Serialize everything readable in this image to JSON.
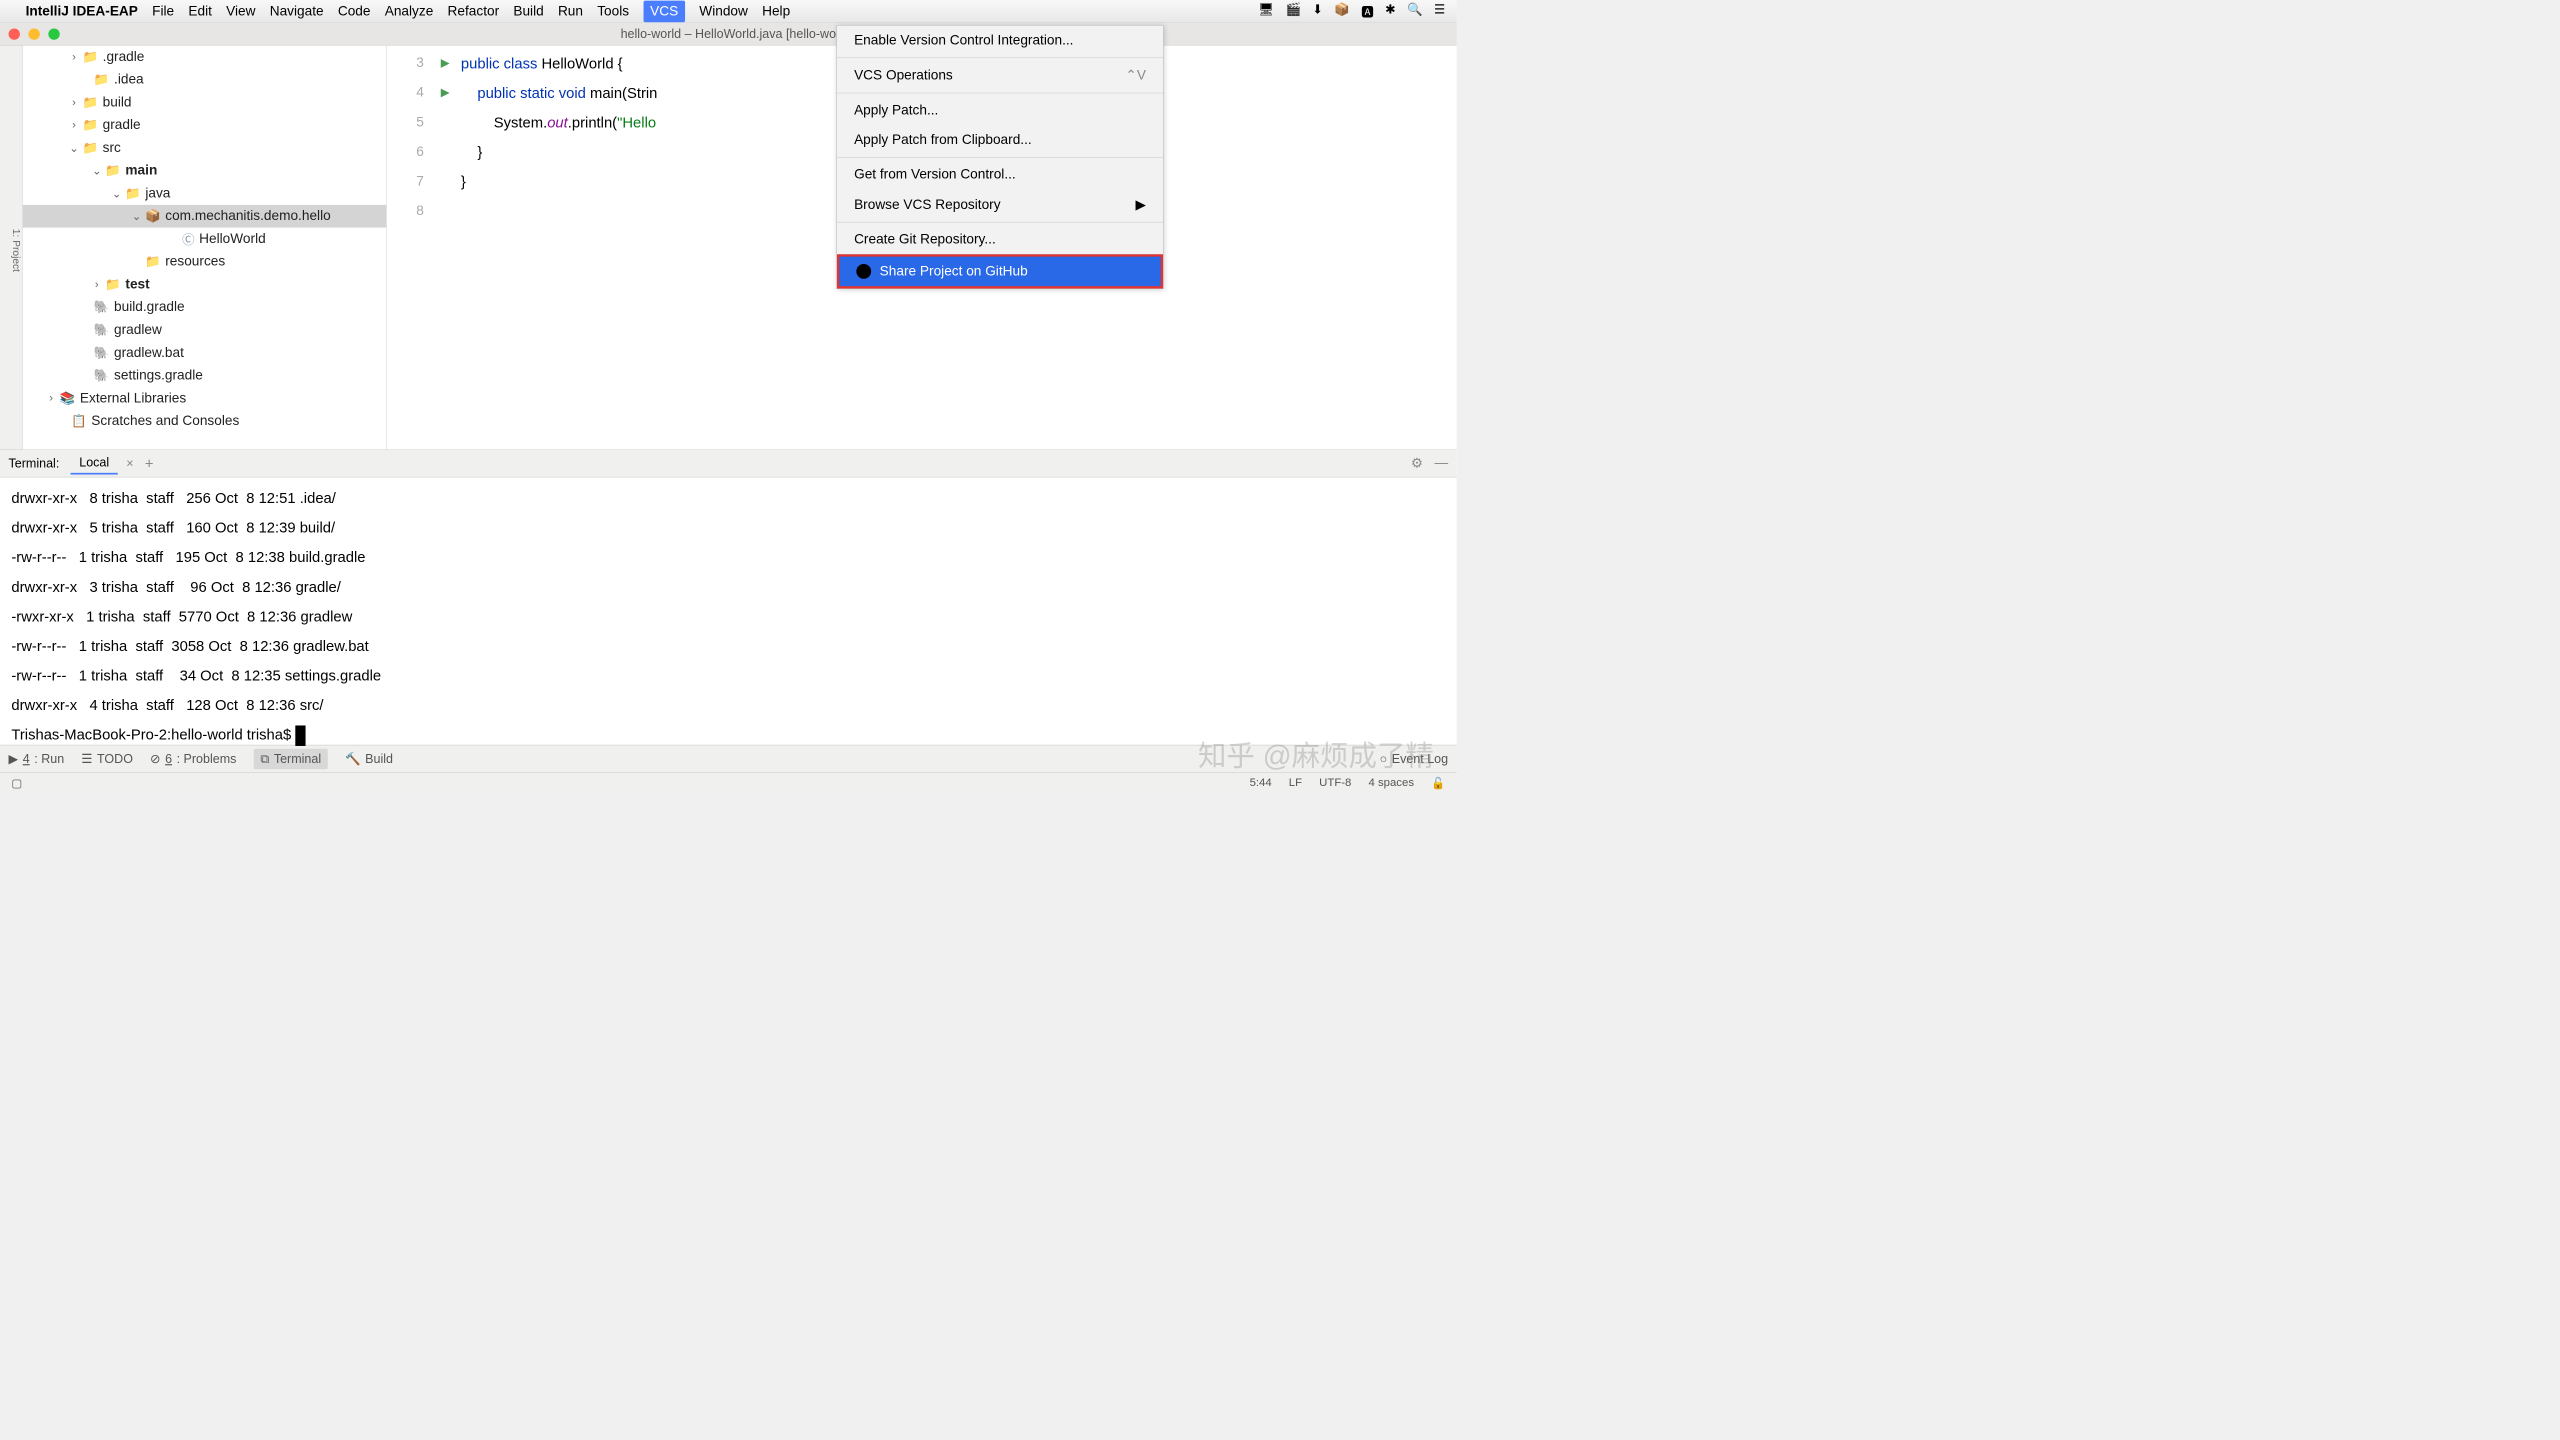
{
  "menubar": {
    "app": "IntelliJ IDEA-EAP",
    "items": [
      "File",
      "Edit",
      "View",
      "Navigate",
      "Code",
      "Analyze",
      "Refactor",
      "Build",
      "Run",
      "Tools",
      "VCS",
      "Window",
      "Help"
    ]
  },
  "titlebar": "hello-world – HelloWorld.java [hello-wo",
  "tree": {
    "items": [
      {
        "ind": 80,
        "chev": "›",
        "icon": "📁",
        "cls": "orange",
        "label": ".gradle"
      },
      {
        "ind": 100,
        "chev": "",
        "icon": "📁",
        "cls": "orange",
        "label": ".idea"
      },
      {
        "ind": 80,
        "chev": "›",
        "icon": "📁",
        "cls": "orange",
        "label": "build"
      },
      {
        "ind": 80,
        "chev": "›",
        "icon": "📁",
        "cls": "orange",
        "label": "gradle"
      },
      {
        "ind": 80,
        "chev": "⌄",
        "icon": "📁",
        "cls": "blue",
        "label": "src"
      },
      {
        "ind": 120,
        "chev": "⌄",
        "icon": "📁",
        "cls": "blue",
        "label": "main",
        "bold": true
      },
      {
        "ind": 155,
        "chev": "⌄",
        "icon": "📁",
        "cls": "blue",
        "label": "java"
      },
      {
        "ind": 190,
        "chev": "⌄",
        "icon": "📦",
        "cls": "",
        "label": "com.mechanitis.demo.hello",
        "sel": true
      },
      {
        "ind": 255,
        "chev": "",
        "icon": "Ⓒ",
        "cls": "",
        "label": "HelloWorld"
      },
      {
        "ind": 190,
        "chev": "",
        "icon": "📁",
        "cls": "orange",
        "label": "resources"
      },
      {
        "ind": 120,
        "chev": "›",
        "icon": "📁",
        "cls": "blue",
        "label": "test",
        "bold": true
      },
      {
        "ind": 100,
        "chev": "",
        "icon": "🐘",
        "cls": "",
        "label": "build.gradle"
      },
      {
        "ind": 100,
        "chev": "",
        "icon": "🐘",
        "cls": "",
        "label": "gradlew"
      },
      {
        "ind": 100,
        "chev": "",
        "icon": "🐘",
        "cls": "",
        "label": "gradlew.bat"
      },
      {
        "ind": 100,
        "chev": "",
        "icon": "🐘",
        "cls": "",
        "label": "settings.gradle"
      },
      {
        "ind": 40,
        "chev": "›",
        "icon": "📚",
        "cls": "",
        "label": "External Libraries"
      },
      {
        "ind": 60,
        "chev": "",
        "icon": "📋",
        "cls": "",
        "label": "Scratches and Consoles"
      }
    ]
  },
  "gutter": [
    "3",
    "4",
    "5",
    "6",
    "7",
    "8"
  ],
  "code_lines": [
    {
      "tokens": [
        {
          "t": "public ",
          "c": "kw"
        },
        {
          "t": "class ",
          "c": "kw"
        },
        {
          "t": "HelloWorld {",
          "c": "id"
        }
      ]
    },
    {
      "tokens": [
        {
          "t": "    ",
          "c": ""
        },
        {
          "t": "public static void ",
          "c": "kw"
        },
        {
          "t": "main",
          "c": "id"
        },
        {
          "t": "(Strin",
          "c": "id"
        }
      ]
    },
    {
      "tokens": [
        {
          "t": "        System.",
          "c": "id"
        },
        {
          "t": "out",
          "c": "field"
        },
        {
          "t": ".println(",
          "c": "id"
        },
        {
          "t": "\"Hello",
          "c": "str"
        }
      ]
    },
    {
      "tokens": [
        {
          "t": "    }",
          "c": "id"
        }
      ]
    },
    {
      "tokens": [
        {
          "t": "}",
          "c": "id"
        }
      ]
    },
    {
      "tokens": [
        {
          "t": "",
          "c": ""
        }
      ]
    }
  ],
  "vcs_menu": [
    {
      "label": "Enable Version Control Integration...",
      "type": "item"
    },
    {
      "type": "sep"
    },
    {
      "label": "VCS Operations",
      "shortcut": "⌃V",
      "type": "item"
    },
    {
      "type": "sep"
    },
    {
      "label": "Apply Patch...",
      "type": "item"
    },
    {
      "label": "Apply Patch from Clipboard...",
      "type": "item"
    },
    {
      "type": "sep"
    },
    {
      "label": "Get from Version Control...",
      "type": "item"
    },
    {
      "label": "Browse VCS Repository",
      "arrow": "▶",
      "type": "item"
    },
    {
      "type": "sep"
    },
    {
      "label": "Create Git Repository...",
      "type": "item"
    },
    {
      "label": "Share Project on GitHub",
      "icon": "gh",
      "highlighted": true,
      "type": "item"
    }
  ],
  "terminal": {
    "title": "Terminal:",
    "tab": "Local",
    "lines": [
      "drwxr-xr-x   8 trisha  staff   256 Oct  8 12:51 .idea/",
      "drwxr-xr-x   5 trisha  staff   160 Oct  8 12:39 build/",
      "-rw-r--r--   1 trisha  staff   195 Oct  8 12:38 build.gradle",
      "drwxr-xr-x   3 trisha  staff    96 Oct  8 12:36 gradle/",
      "-rwxr-xr-x   1 trisha  staff  5770 Oct  8 12:36 gradlew",
      "-rw-r--r--   1 trisha  staff  3058 Oct  8 12:36 gradlew.bat",
      "-rw-r--r--   1 trisha  staff    34 Oct  8 12:35 settings.gradle",
      "drwxr-xr-x   4 trisha  staff   128 Oct  8 12:36 src/"
    ],
    "prompt": "Trishas-MacBook-Pro-2:hello-world trisha$ "
  },
  "bottom_tabs": {
    "run": "4: Run",
    "todo": "TODO",
    "problems": "6: Problems",
    "terminal": "Terminal",
    "build": "Build",
    "event": "Event Log"
  },
  "status": {
    "pos": "5:44",
    "le": "LF",
    "enc": "UTF-8",
    "indent": "4 spaces"
  },
  "watermark": "知乎 @麻烦成了精"
}
